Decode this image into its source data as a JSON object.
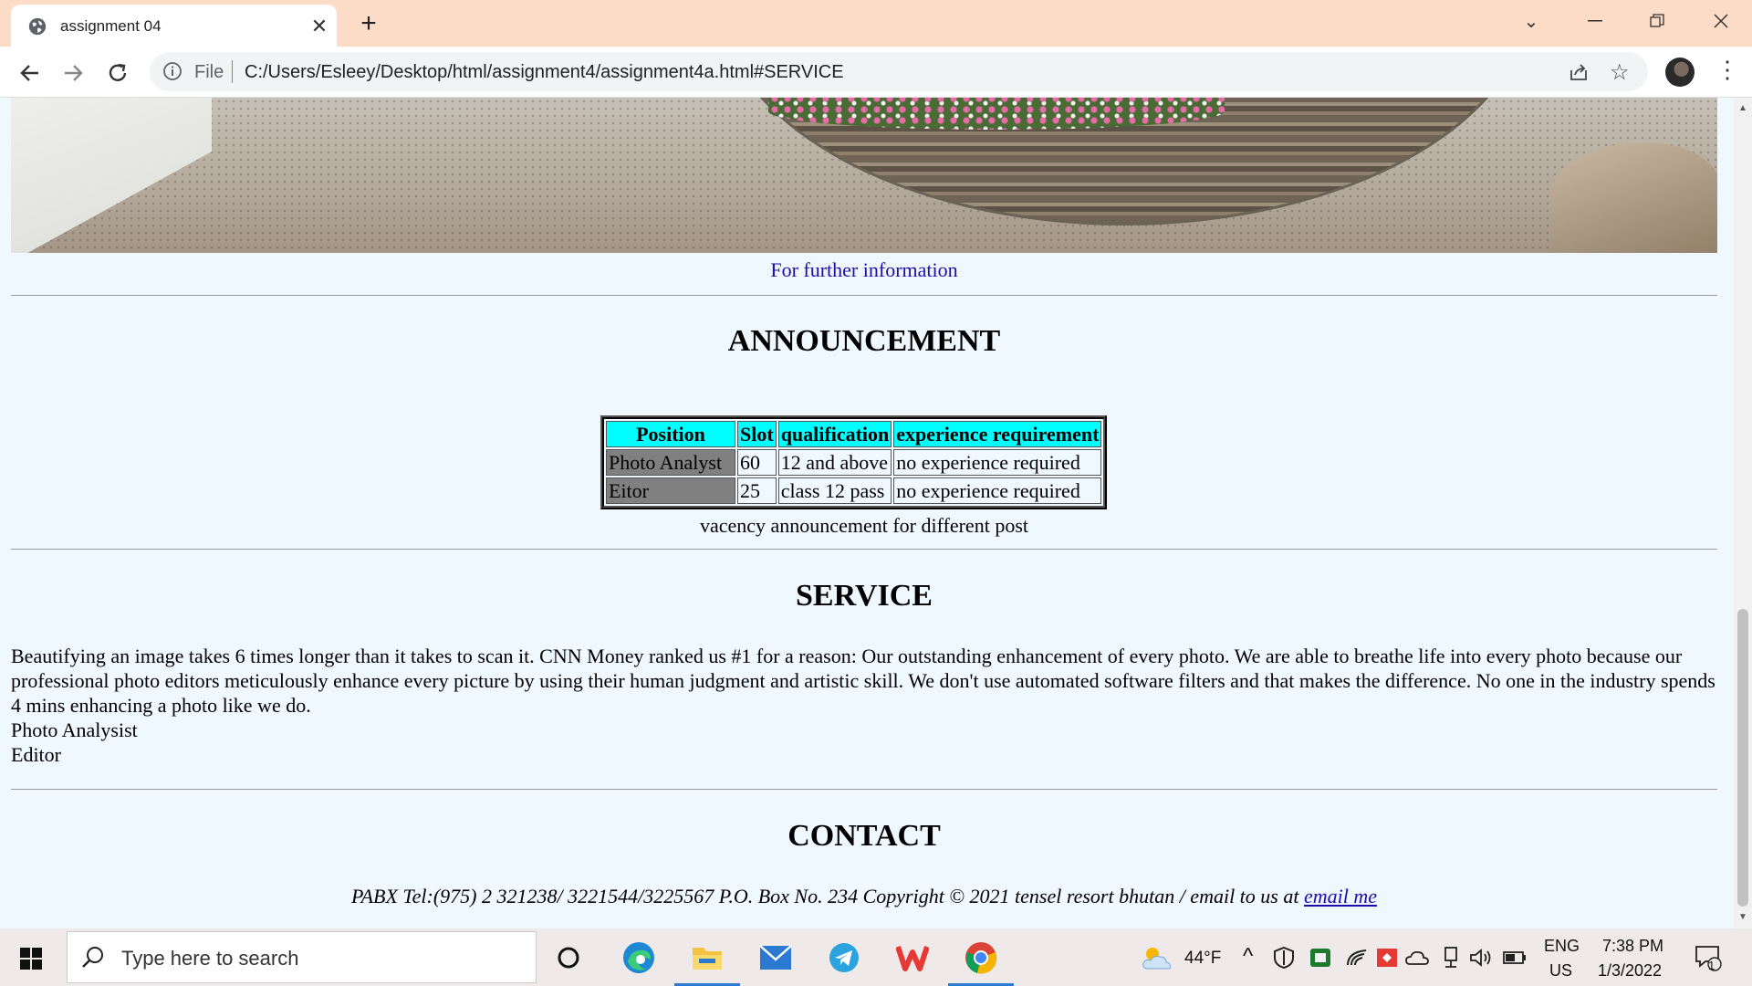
{
  "browser": {
    "tab_title": "assignment 04",
    "omnibox_scheme": "File",
    "url": "C:/Users/Esleey/Desktop/html/assignment4/assignment4a.html#SERVICE"
  },
  "page": {
    "further_link": "For further information",
    "announcement": {
      "heading": "ANNOUNCEMENT",
      "columns": [
        "Position",
        "Slot",
        "qualification",
        "experience requirement"
      ],
      "rows": [
        [
          "Photo Analyst",
          "60",
          "12 and above",
          "no experience required"
        ],
        [
          "Eitor",
          "25",
          "class 12 pass",
          "no experience required"
        ]
      ],
      "caption": "vacency announcement for different post"
    },
    "service": {
      "heading": "SERVICE",
      "paragraph": "Beautifying an image takes 6 times longer than it takes to scan it. CNN Money ranked us #1 for a reason: Our outstanding enhancement of every photo. We are able to breathe life into every photo because our professional photo editors meticulously enhance every picture by using their human judgment and artistic skill. We don't use automated software filters and that makes the difference. No one in the industry spends 4 mins enhancing a photo like we do.",
      "items": [
        "Photo Analysist",
        "Editor"
      ]
    },
    "contact": {
      "heading": "CONTACT",
      "text": "PABX Tel:(975) 2 321238/ 3221544/3225567 P.O. Box No. 234 Copyright © 2021 tensel resort bhutan / email to us at ",
      "link": "email me"
    }
  },
  "taskbar": {
    "search_placeholder": "Type here to search",
    "weather": "44°F",
    "language": "ENG",
    "region": "US",
    "time": "7:38 PM",
    "date": "1/3/2022",
    "notification_count": "1"
  },
  "icons": {
    "apps": [
      "cortana-icon",
      "edge-icon",
      "file-explorer-icon",
      "mail-icon",
      "telegram-icon",
      "wps-office-icon",
      "chrome-icon"
    ]
  }
}
